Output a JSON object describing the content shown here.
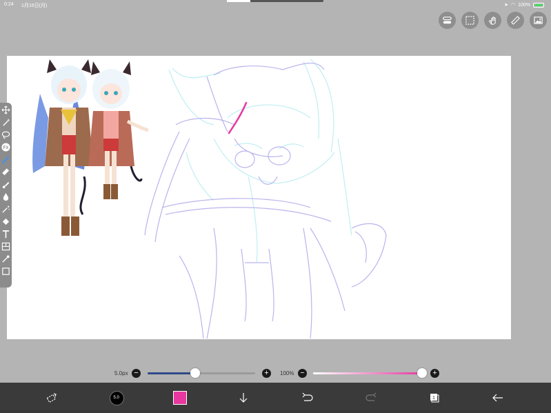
{
  "status_bar": {
    "time": "0:24",
    "date": "1月16日(月)",
    "battery": "100%"
  },
  "top_tools": [
    "layer-toggle",
    "selection",
    "touch",
    "ruler",
    "material"
  ],
  "left_toolbar": [
    "move",
    "magic-wand",
    "lasso",
    "filter",
    "brush",
    "eraser",
    "smudge",
    "blur",
    "bucket",
    "magic-brush",
    "fill",
    "text",
    "frame",
    "eyedropper",
    "square"
  ],
  "brush_controls": {
    "size_label": "5.0px",
    "size_level": 0.44,
    "opacity_label": "100%",
    "opacity_level": 1.0,
    "minus": "−",
    "plus": "+"
  },
  "bottom_bar": {
    "brush_size_badge": "5.0",
    "colors": {
      "accent": "#e8379f",
      "size_track": "#2f4a8a",
      "sketch_purple": "#b9b4ec",
      "sketch_cyan": "#bfeef2"
    }
  }
}
